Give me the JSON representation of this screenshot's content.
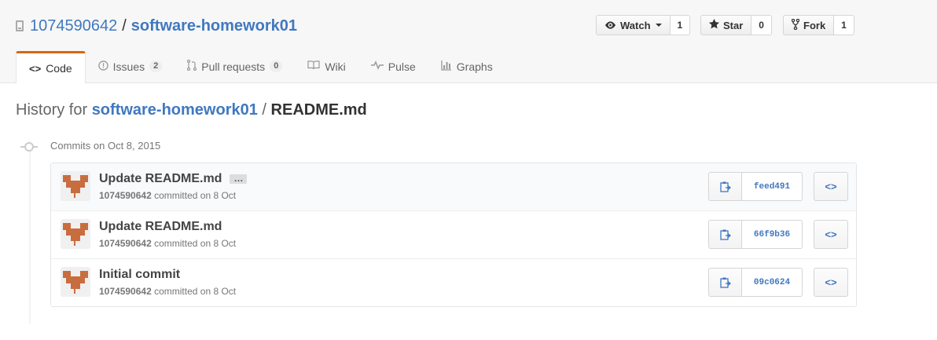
{
  "repo": {
    "owner": "1074590642",
    "separator": "/",
    "name": "software-homework01"
  },
  "actions": {
    "watch": {
      "label": "Watch",
      "count": "1",
      "icon": "eye-icon"
    },
    "star": {
      "label": "Star",
      "count": "0",
      "icon": "star-icon"
    },
    "fork": {
      "label": "Fork",
      "count": "1",
      "icon": "fork-icon"
    }
  },
  "tabs": [
    {
      "label": "Code",
      "icon": "code-icon",
      "selected": true
    },
    {
      "label": "Issues",
      "icon": "issue-icon",
      "count": "2"
    },
    {
      "label": "Pull requests",
      "icon": "pull-request-icon",
      "count": "0"
    },
    {
      "label": "Wiki",
      "icon": "book-icon"
    },
    {
      "label": "Pulse",
      "icon": "pulse-icon"
    },
    {
      "label": "Graphs",
      "icon": "graph-icon"
    }
  ],
  "history": {
    "prefix": "History for",
    "repo_link": "software-homework01",
    "separator": "/",
    "file": "README.md"
  },
  "commit_group": {
    "date_label": "Commits on Oct 8, 2015"
  },
  "commits": [
    {
      "message": "Update README.md",
      "has_ellipsis": true,
      "ellipsis": "…",
      "author": "1074590642",
      "committed": "committed on 8 Oct",
      "sha": "feed491"
    },
    {
      "message": "Update README.md",
      "author": "1074590642",
      "committed": "committed on 8 Oct",
      "sha": "66f9b36"
    },
    {
      "message": "Initial commit",
      "author": "1074590642",
      "committed": "committed on 8 Oct",
      "sha": "09c0624"
    }
  ],
  "browse_label": "<>",
  "colors": {
    "link": "#4078c0",
    "tab_accent": "#d26911",
    "avatar": "#c96d3f"
  }
}
